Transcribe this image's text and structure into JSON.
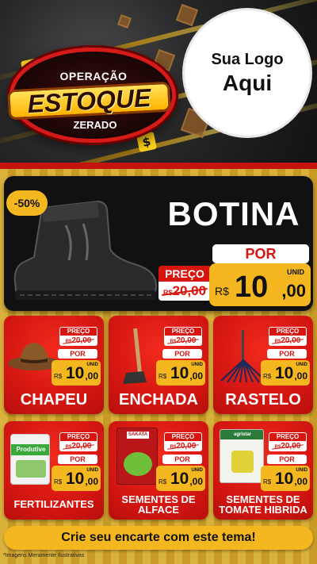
{
  "header": {
    "badge_top": "OPERAÇÃO",
    "badge_main": "ESTOQUE",
    "badge_bottom": "ZERADO",
    "logo_line1": "Sua Logo",
    "logo_line2": "Aqui"
  },
  "featured": {
    "discount": "-50%",
    "title": "BOTINA",
    "preco_label": "PREÇO",
    "old_currency": "R$",
    "old_price": "20,00",
    "por_label": "POR",
    "unid_label": "UNID",
    "new_currency": "R$",
    "new_price_int": "10",
    "new_price_dec": ",00"
  },
  "cards": [
    {
      "title": "CHAPEU",
      "preco_label": "PREÇO",
      "old_currency": "R$",
      "old_price": "20,00",
      "por_label": "POR",
      "unid_label": "UNID",
      "new_currency": "R$",
      "new_price_int": "10",
      "new_price_dec": ",00",
      "icon": "hat-icon"
    },
    {
      "title": "ENCHADA",
      "preco_label": "PREÇO",
      "old_currency": "R$",
      "old_price": "20,00",
      "por_label": "POR",
      "unid_label": "UNID",
      "new_currency": "R$",
      "new_price_int": "10",
      "new_price_dec": ",00",
      "icon": "hoe-icon"
    },
    {
      "title": "RASTELO",
      "preco_label": "PREÇO",
      "old_currency": "R$",
      "old_price": "20,00",
      "por_label": "POR",
      "unid_label": "UNID",
      "new_currency": "R$",
      "new_price_int": "10",
      "new_price_dec": ",00",
      "icon": "rake-icon"
    },
    {
      "title": "FERTILIZANTES",
      "image_text": "Produtive",
      "preco_label": "PREÇO",
      "old_currency": "R$",
      "old_price": "20,00",
      "por_label": "POR",
      "unid_label": "UNID",
      "new_currency": "R$",
      "new_price_int": "10",
      "new_price_dec": ",00",
      "icon": "fertilizer-bag-icon"
    },
    {
      "title_line1": "SEMENTES DE",
      "title_line2": "ALFACE",
      "image_text": "SAKATA",
      "preco_label": "PREÇO",
      "old_currency": "R$",
      "old_price": "20,00",
      "por_label": "POR",
      "unid_label": "UNID",
      "new_currency": "R$",
      "new_price_int": "10",
      "new_price_dec": ",00",
      "icon": "seed-packet-icon"
    },
    {
      "title_line1": "SEMENTES DE",
      "title_line2": "TOMATE HIBRIDA",
      "image_text": "agristar",
      "preco_label": "PREÇO",
      "old_currency": "R$",
      "old_price": "20,00",
      "por_label": "POR",
      "unid_label": "UNID",
      "new_currency": "R$",
      "new_price_int": "10",
      "new_price_dec": ",00",
      "icon": "seed-packet-icon"
    }
  ],
  "footer": {
    "cta": "Crie seu encarte com este tema!",
    "disclaimer": "*Imagens Meramente Ilustrativas"
  },
  "colors": {
    "red": "#d8140f",
    "yellow": "#f4b71f",
    "dark": "#111111"
  }
}
